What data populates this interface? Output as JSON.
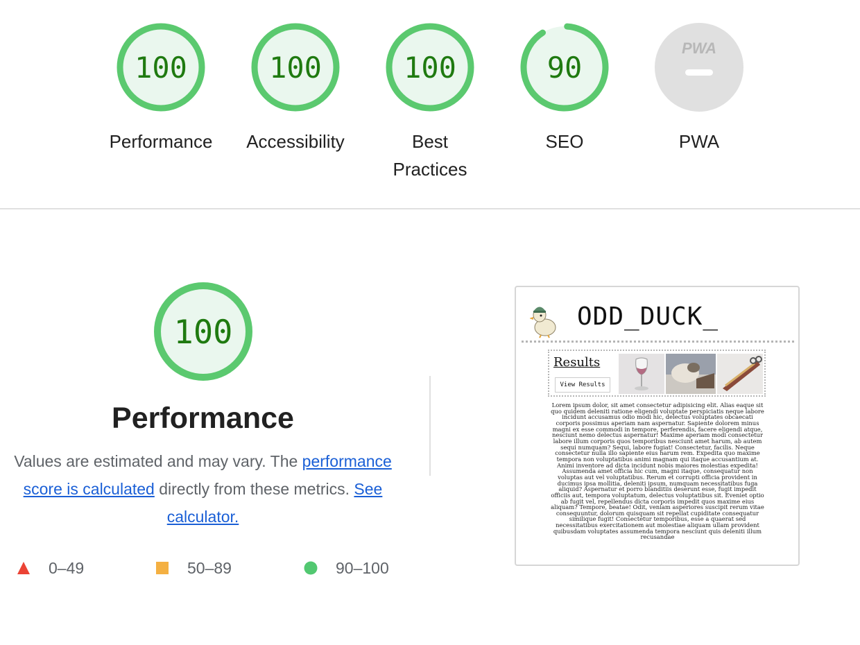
{
  "gauges": [
    {
      "label": "Performance",
      "score": "100",
      "value": 100
    },
    {
      "label": "Accessibility",
      "score": "100",
      "value": 100
    },
    {
      "label": "Best Practices",
      "score": "100",
      "value": 100
    },
    {
      "label": "SEO",
      "score": "90",
      "value": 90
    },
    {
      "label": "PWA",
      "badge": "PWA",
      "value": null
    }
  ],
  "performance": {
    "score": "100",
    "title": "Performance",
    "desc_prefix": "Values are estimated and may vary. The ",
    "link_score": "performance score is calculated",
    "desc_middle": " directly from these metrics. ",
    "link_calculator": "See calculator."
  },
  "legend": [
    {
      "range": "0–49",
      "shape": "triangle",
      "color": "#eb4335"
    },
    {
      "range": "50–89",
      "shape": "square",
      "color": "#f4b042"
    },
    {
      "range": "90–100",
      "shape": "circle",
      "color": "#52c871"
    }
  ],
  "thumbnail": {
    "site_title": "ODD_DUCK_",
    "results_heading": "Results",
    "view_button": "View Results",
    "lorem": "Lorem ipsum dolor, sit amet consectetur adipisicing elit. Alias eaque sit quo quidem deleniti ratione eligendi voluptate perspiciatis neque labore incidunt accusamus odio modi hic, delectus voluptates obcaecati corporis possimus aperiam nam aspernatur. Sapiente dolorem minus magni ex esse commodi in tempore, perferendis, facere eligendi atque, nesciunt nemo delectus aspernatur! Maxime aperiam modi consectetur labore illum corporis quos temporibus nesciunt amet harum, ab autem sequi numquam? Sequi, labore fugiat! Consectetur, facilis. Neque consectetur nulla illo sapiente eius harum rem. Expedita quo maxime tempora non voluptatibus animi magnam qui itaque accusantium at. Animi inventore ad dicta incidunt nobis maiores molestias expedita! Assumenda amet officia hic cum, magni itaque, consequatur non voluptas aut vel voluptatibus. Rerum et corrupti officia provident in ducimus ipsa mollitia, deleniti ipsum, numquam necessitatibus fuga aliquid? Aspernatur et porro blanditiis deserunt esse, fugit impedit officiis aut, tempora voluptatum, delectus voluptatibus sit. Eveniet optio ab fugit vel, repellendus dicta corporis impedit quos maxime eius aliquam? Tempore, beatae! Odit, veniam asperiores suscipit rerum vitae consequuntur, dolorum quisquam sit repellat cupiditate consequatur similique fugit! Consectetur temporibus, esse a quaerat sed necessitatibus exercitationem aut molestiae aliquam ullam provident quibusdam voluptates assumenda tempora nesciunt quis deleniti illum recusandae"
  },
  "colors": {
    "pass": "#0cce6b",
    "pass_ring": "#5bc96f",
    "pass_fill": "#eaf7ee",
    "pass_text": "#1f7a10",
    "na": "#e0e0e0",
    "link": "#1a5fd6"
  }
}
